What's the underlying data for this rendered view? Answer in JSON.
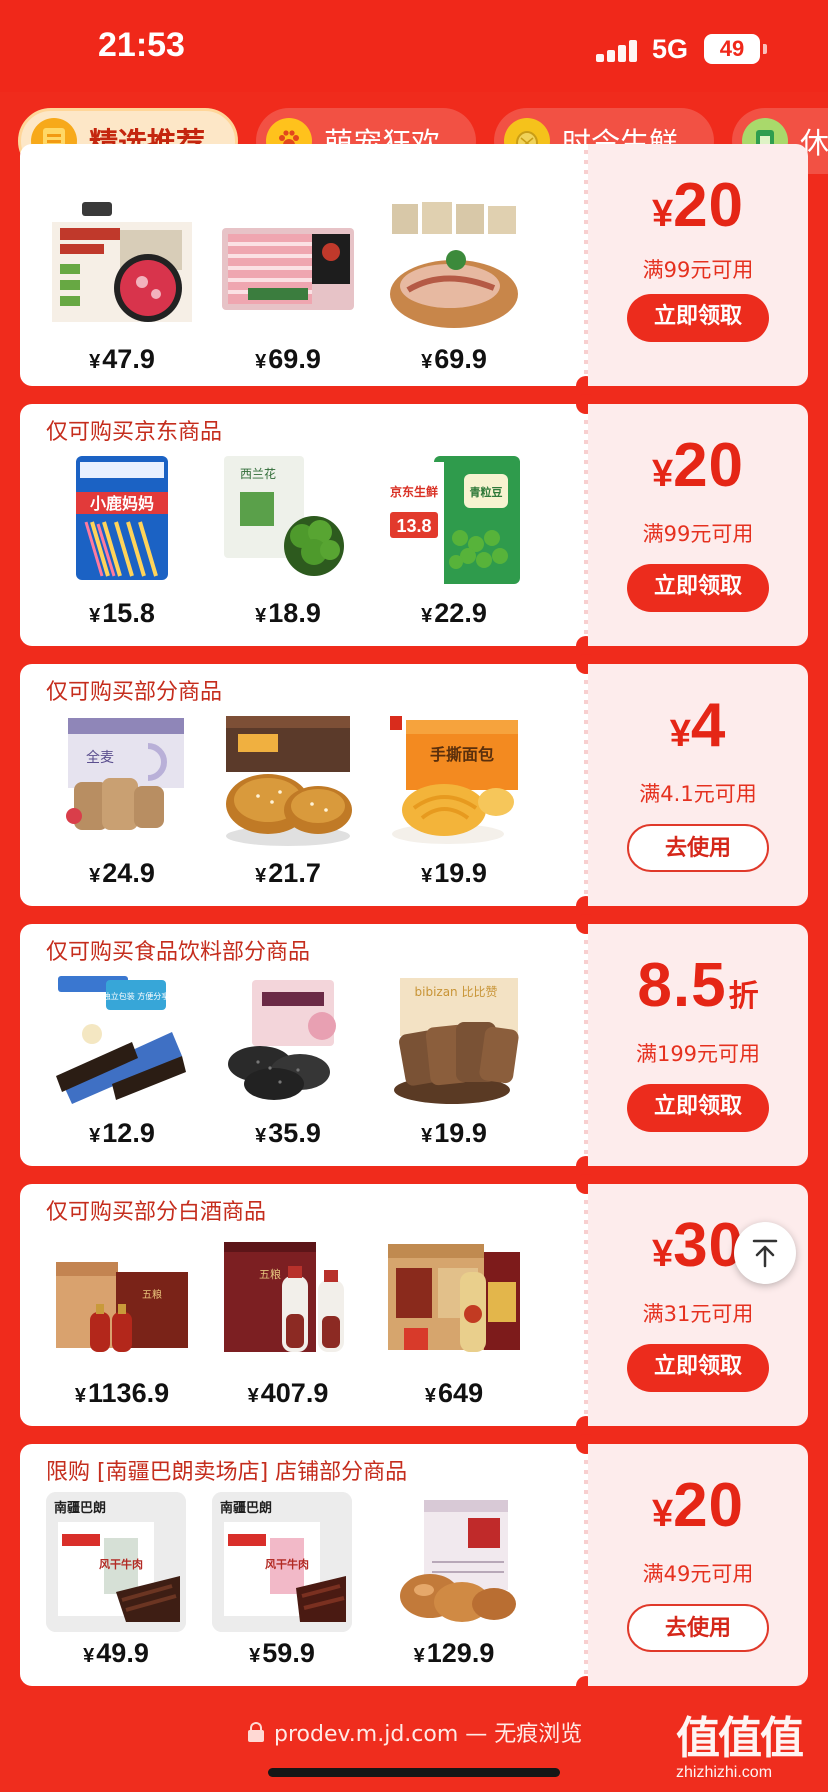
{
  "status_bar": {
    "time": "21:53",
    "network": "5G",
    "battery": "49"
  },
  "tabs": [
    {
      "label": "精选推荐",
      "icon": "coupon-icon",
      "active": true
    },
    {
      "label": "萌宠狂欢",
      "icon": "paw-icon",
      "active": false
    },
    {
      "label": "时令生鲜",
      "icon": "durian-icon",
      "active": false
    },
    {
      "label": "休",
      "icon": "snack-icon",
      "active": false
    }
  ],
  "coupons": [
    {
      "head": "",
      "amount_prefix": "¥",
      "amount": "20",
      "amount_suffix": "",
      "condition": "满99元可用",
      "action": "立即领取",
      "action_type": "claim",
      "products": [
        {
          "price": "47.9",
          "image": "beef-slices-box"
        },
        {
          "price": "69.9",
          "image": "beef-roll-pack"
        },
        {
          "price": "69.9",
          "image": "bacon-plate"
        }
      ]
    },
    {
      "head": "仅可购买京东商品",
      "amount_prefix": "¥",
      "amount": "20",
      "amount_suffix": "",
      "condition": "满99元可用",
      "action": "立即领取",
      "action_type": "claim",
      "products": [
        {
          "price": "15.8",
          "image": "toothbrush-pack",
          "brand_text": "小鹿妈妈"
        },
        {
          "price": "18.9",
          "image": "broccoli-bag",
          "brand_text": "西兰花"
        },
        {
          "price": "22.9",
          "image": "green-peas-bag",
          "brand_text": "京东生鲜",
          "badge": "13.8",
          "pack_text": "青粒豆"
        }
      ]
    },
    {
      "head": "仅可购买部分商品",
      "amount_prefix": "¥",
      "amount": "4",
      "amount_suffix": "",
      "condition": "满4.1元可用",
      "action": "去使用",
      "action_type": "use",
      "products": [
        {
          "price": "24.9",
          "image": "whole-wheat-bread",
          "pack_text": "全麦"
        },
        {
          "price": "21.7",
          "image": "sesame-pastry"
        },
        {
          "price": "19.9",
          "image": "hand-torn-bread",
          "pack_text": "手撕面包"
        }
      ]
    },
    {
      "head": "仅可购买食品饮料部分商品",
      "amount_prefix": "",
      "amount": "8.5",
      "amount_suffix": "折",
      "condition": "满199元可用",
      "action": "立即领取",
      "action_type": "claim",
      "products": [
        {
          "price": "12.9",
          "image": "chocolate-wafers",
          "pack_text": "独立包装 方便分享"
        },
        {
          "price": "35.9",
          "image": "black-sesame-cakes"
        },
        {
          "price": "19.9",
          "image": "rye-toast",
          "brand_text": "bibizan 比比赞"
        }
      ]
    },
    {
      "head": "仅可购买部分白酒商品",
      "amount_prefix": "¥",
      "amount": "30",
      "amount_suffix": "",
      "condition": "满31元可用",
      "action": "立即领取",
      "action_type": "claim",
      "products": [
        {
          "price": "1136.9",
          "image": "baijiu-gift-box",
          "pack_text": "五粮"
        },
        {
          "price": "407.9",
          "image": "baijiu-red-box",
          "pack_text": "五粮"
        },
        {
          "price": "649",
          "image": "baijiu-cases"
        }
      ]
    },
    {
      "head": "限购 [南疆巴朗卖场店] 店铺部分商品",
      "amount_prefix": "¥",
      "amount": "20",
      "amount_suffix": "",
      "condition": "满49元可用",
      "action": "去使用",
      "action_type": "use",
      "products": [
        {
          "price": "49.9",
          "image": "dried-beef-pack",
          "brand_text": "南疆巴朗",
          "pack_text": "风干牛肉"
        },
        {
          "price": "59.9",
          "image": "dried-beef-pack-2",
          "brand_text": "南疆巴朗",
          "pack_text": "风干牛肉"
        },
        {
          "price": "129.9",
          "image": "beef-tendon-snack"
        }
      ]
    }
  ],
  "bottom_bar": {
    "url": "prodev.m.jd.com — 无痕浏览",
    "watermark_logo": "值值值",
    "watermark_text": "zhizhizhi.com"
  },
  "colors": {
    "brand_red": "#f02b1c",
    "coupon_text_red": "#e52616",
    "tab_active_bg": "#fde7c7"
  }
}
